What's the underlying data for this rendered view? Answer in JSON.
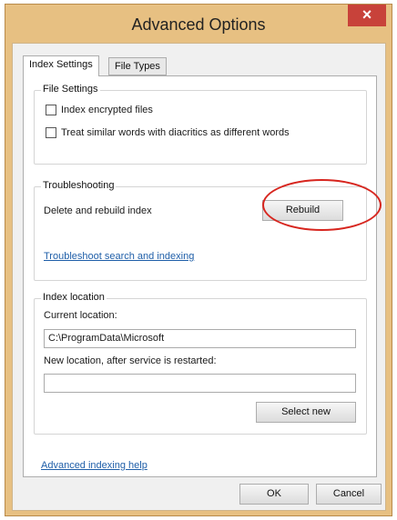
{
  "window": {
    "title": "Advanced Options",
    "close_glyph": "×"
  },
  "tabs": [
    {
      "label": "Index Settings"
    },
    {
      "label": "File Types"
    }
  ],
  "file_settings": {
    "label": "File Settings",
    "index_encrypted": "Index encrypted files",
    "treat_similar": "Treat similar words with diacritics as different words"
  },
  "troubleshooting": {
    "label": "Troubleshooting",
    "delete_rebuild": "Delete and rebuild index",
    "rebuild_button": "Rebuild",
    "troubleshoot_link": "Troubleshoot search and indexing"
  },
  "index_location": {
    "label": "Index location",
    "current_label": "Current location:",
    "current_value": "C:\\ProgramData\\Microsoft",
    "new_label": "New location, after service is restarted:",
    "new_value": "",
    "select_new_button": "Select new"
  },
  "footer": {
    "help_link": "Advanced indexing help",
    "ok_button": "OK",
    "cancel_button": "Cancel"
  },
  "colors": {
    "frame": "#e7c082",
    "close": "#c8423a",
    "link": "#1e5ea8",
    "annotation": "#d7261f"
  }
}
